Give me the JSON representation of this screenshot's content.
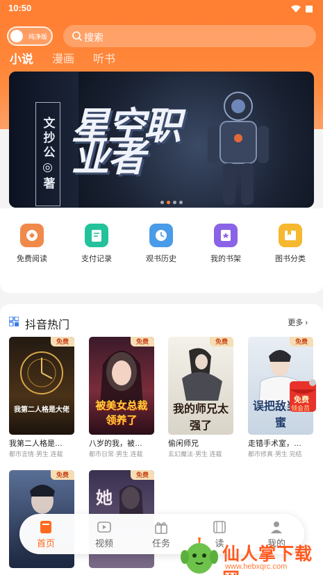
{
  "status": {
    "time": "10:50"
  },
  "header": {
    "toggle_label": "纯净版",
    "search_placeholder": "搜索",
    "tabs": [
      {
        "label": "小说",
        "active": true
      },
      {
        "label": "漫画",
        "active": false
      },
      {
        "label": "听书",
        "active": false
      }
    ]
  },
  "banner": {
    "author": "文抄公◎著",
    "title": "星空职业者",
    "slide_count": 4,
    "active_slide": 2
  },
  "quick_actions": [
    {
      "label": "免费阅读",
      "icon": "free-read-icon",
      "color": "#f08a4b"
    },
    {
      "label": "支付记录",
      "icon": "payment-record-icon",
      "color": "#23c29a"
    },
    {
      "label": "观书历史",
      "icon": "history-clock-icon",
      "color": "#4a9be8"
    },
    {
      "label": "我的书架",
      "icon": "bookshelf-icon",
      "color": "#8b63e6"
    },
    {
      "label": "图书分类",
      "icon": "category-icon",
      "color": "#f5b82e"
    }
  ],
  "section": {
    "title": "抖音热门",
    "more": "更多",
    "books": [
      {
        "title": "我第二人格是…",
        "meta": "都市言情·男生 连载",
        "badge": "免费",
        "cover_text": "我第二人格是大佬",
        "cover_color": "#3a2a1a"
      },
      {
        "title": "八岁的我，被…",
        "meta": "都市日常·男生 连载",
        "badge": "免费",
        "cover_text": "被美女总裁领养了",
        "cover_color": "#2a1420"
      },
      {
        "title": "偷闲师兄",
        "meta": "玄幻魔法·男生 连载",
        "badge": "免费",
        "cover_text": "我的师兄太强了",
        "cover_color": "#e8e4dc"
      },
      {
        "title": "走错手术室，…",
        "meta": "都市修真·男生 完结",
        "badge": "免费",
        "cover_text": "误把敌当闺蜜",
        "cover_color": "#dde6ef"
      },
      {
        "title": "",
        "meta": "",
        "badge": "免费",
        "cover_text": "",
        "cover_color": "#26344f"
      },
      {
        "title": "",
        "meta": "",
        "badge": "免费",
        "cover_text": "她",
        "cover_color": "#5a4a6a"
      }
    ],
    "promo": {
      "top": "免费",
      "bottom": "领会员"
    }
  },
  "bottom_nav": [
    {
      "label": "首页",
      "icon": "home-book-icon",
      "active": true
    },
    {
      "label": "视频",
      "icon": "video-icon",
      "active": false
    },
    {
      "label": "任务",
      "icon": "gift-icon",
      "active": false
    },
    {
      "label": "读",
      "icon": "film-icon",
      "active": false
    },
    {
      "label": "我的",
      "icon": "profile-icon",
      "active": false
    }
  ],
  "watermark": {
    "name": "仙人掌下载网",
    "url": "www.hebxqrc.com"
  },
  "colors": {
    "accent": "#ff7f33",
    "badge_bg": "#f6ddb4",
    "badge_text": "#c9471d"
  }
}
